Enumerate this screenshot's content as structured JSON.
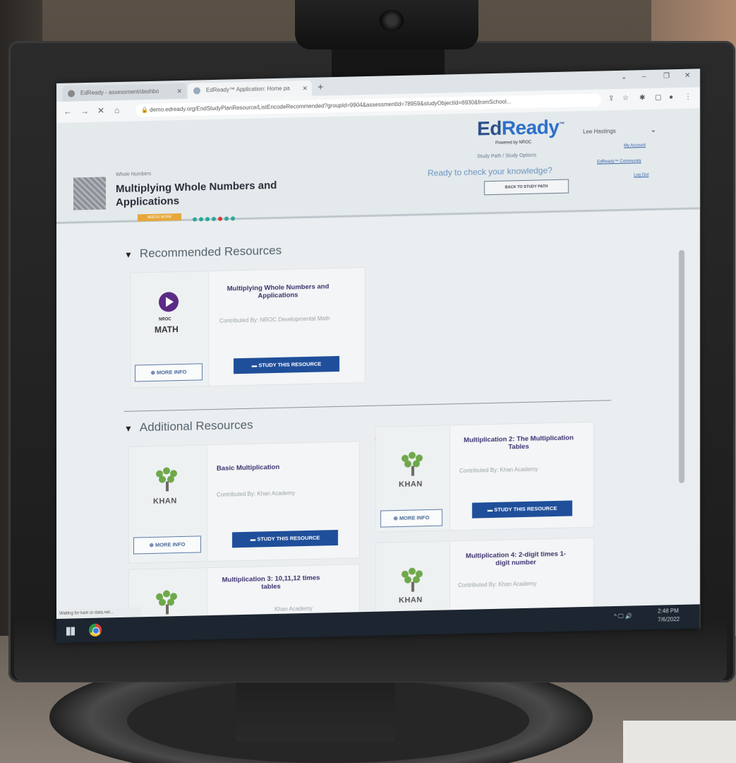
{
  "browser": {
    "tabs": [
      {
        "label": "EdReady - assessment/dashbo"
      },
      {
        "label": "EdReady™ Application: Home pa"
      }
    ],
    "new_tab_symbol": "+",
    "window_controls": [
      "⌄",
      "–",
      "❐",
      "✕"
    ],
    "nav": {
      "back": "←",
      "forward": "→",
      "reload": "✕",
      "home": "⌂"
    },
    "url": "demo.edready.org/EndStudyPlanResource/ListEncodeRecommended?groupId=9904&assessmentId=78959&studyObjectId=6930&fromSchool..."
  },
  "header": {
    "logo_ed": "Ed",
    "logo_ready": "Ready",
    "logo_tm": "™",
    "logo_sub": "Powered by NROC",
    "user_name": "Lee Hastings",
    "breadcrumb": "Whole Numbers",
    "page_title": "Multiplying Whole Numbers and Applications",
    "badge": "NEEDS WORK",
    "study_path": "Study Path / Study Options",
    "ready_prompt": "Ready to check your knowledge?",
    "back_button": "BACK TO STUDY PATH",
    "links": [
      "My Account",
      "EdReady™ Community",
      "Log Out"
    ]
  },
  "recommended": {
    "heading": "Recommended Resources",
    "cards": [
      {
        "provider": "nroc",
        "provider_small": "NROC",
        "provider_big": "MATH",
        "title": "Multiplying Whole Numbers and Applications",
        "contributed": "Contributed By: NROC Developmental Math",
        "more_info": "MORE INFO",
        "study": "STUDY THIS RESOURCE"
      }
    ]
  },
  "additional": {
    "heading": "Additional Resources",
    "cards": [
      {
        "provider": "khan",
        "provider_word": "KHAN",
        "title": "Basic Multiplication",
        "contributed": "Contributed By: Khan Academy",
        "more_info": "MORE INFO",
        "study": "STUDY THIS RESOURCE"
      },
      {
        "provider": "khan",
        "provider_word": "KHAN",
        "title": "Multiplication 2: The Multiplication Tables",
        "contributed": "Contributed By: Khan Academy",
        "more_info": "MORE INFO",
        "study": "STUDY THIS RESOURCE"
      },
      {
        "provider": "khan",
        "provider_word": "KHAN",
        "title": "Multiplication 3: 10,11,12 times tables",
        "contributed": "Khan Academy"
      },
      {
        "provider": "khan",
        "provider_word": "KHAN",
        "title": "Multiplication 4: 2-digit times 1-digit number",
        "contributed": "Contributed By: Khan Academy"
      }
    ]
  },
  "statusbar": {
    "text": "Waiting for kam or data.net..."
  },
  "taskbar": {
    "tray_icons": "^ 🖵 🔊",
    "time": "2:48 PM",
    "date": "7/6/2022"
  },
  "colors": {
    "brand_blue": "#1f4f9a",
    "logo_blue": "#2d6fc9",
    "nroc_purple": "#5b2b85",
    "khan_green": "#6fa84a",
    "badge_orange": "#e6a73a",
    "progress_teal": "#2aa89a",
    "progress_red": "#d03a3a"
  },
  "progress_dots": {
    "total": 7,
    "highlighted_index": 4
  }
}
